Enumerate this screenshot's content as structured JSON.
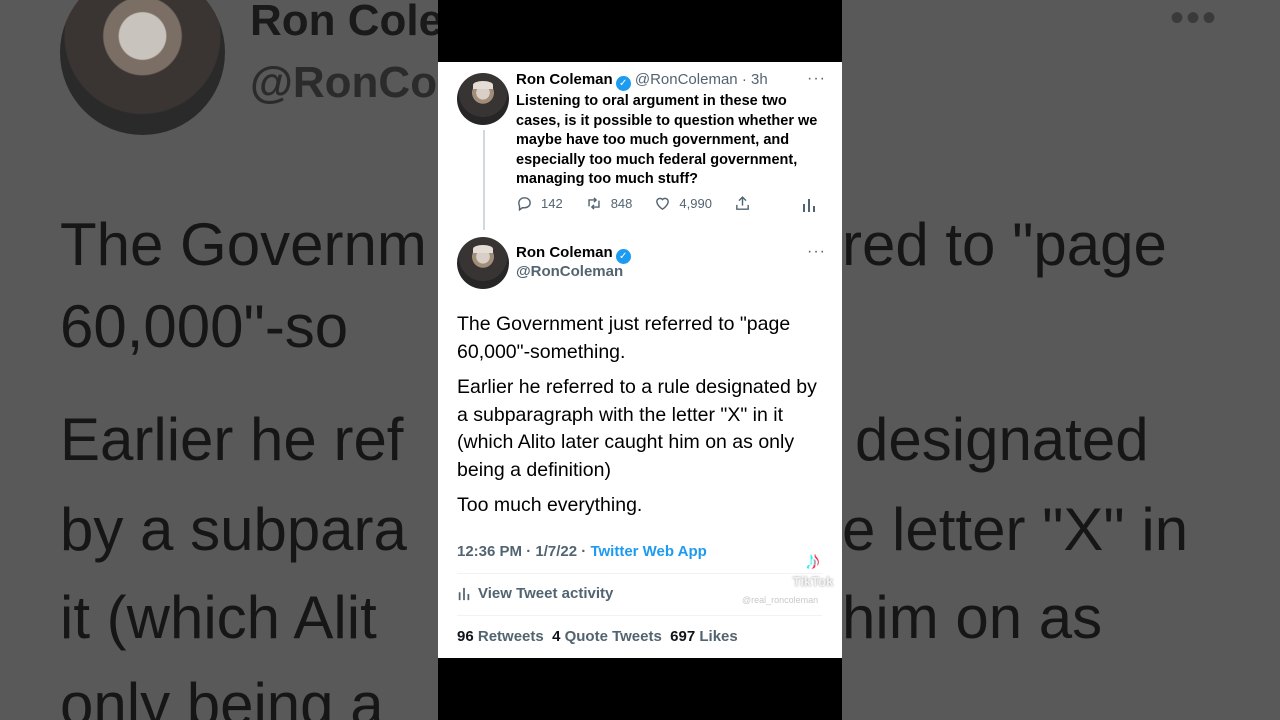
{
  "background": {
    "name": "Ron Cole",
    "handle": "@RonCo",
    "dots": "•••",
    "left_lines": [
      "The Governm",
      "60,000\"-so",
      "Earlier he ref",
      "by a subpara",
      "it (which Alit",
      "only being a"
    ],
    "right_lines": [
      "red to \"page",
      "designated",
      "e letter \"X\" in",
      "him on as"
    ]
  },
  "tweet1": {
    "name": "Ron Coleman",
    "handle": "@RonColeman",
    "time": "3h",
    "separator": "·",
    "more": "···",
    "body": "Listening to oral argument in these two cases, is it possible to question whether we maybe have too much government, and especially too much federal government, managing too much stuff?",
    "replies": "142",
    "retweets": "848",
    "likes": "4,990"
  },
  "tweet2": {
    "name": "Ron Coleman",
    "handle": "@RonColeman",
    "more": "···",
    "paragraphs": [
      "The Government just referred to \"page 60,000\"-something.",
      "Earlier he referred to a rule designated by a subparagraph with the letter \"X\" in it (which Alito later caught him on as only being a definition)",
      "Too much everything."
    ],
    "time": "12:36 PM",
    "date": "1/7/22",
    "separator": "·",
    "source": "Twitter Web App",
    "activity_label": "View Tweet activity",
    "retweets_count": "96",
    "retweets_label": "Retweets",
    "quotes_count": "4",
    "quotes_label": "Quote Tweets",
    "likes_count": "697",
    "likes_label": "Likes"
  },
  "watermark": {
    "brand": "TikTok",
    "user": "@real_roncoleman"
  },
  "colors": {
    "accent": "#1d9bf0",
    "text": "#0f1419",
    "muted": "#536471"
  }
}
